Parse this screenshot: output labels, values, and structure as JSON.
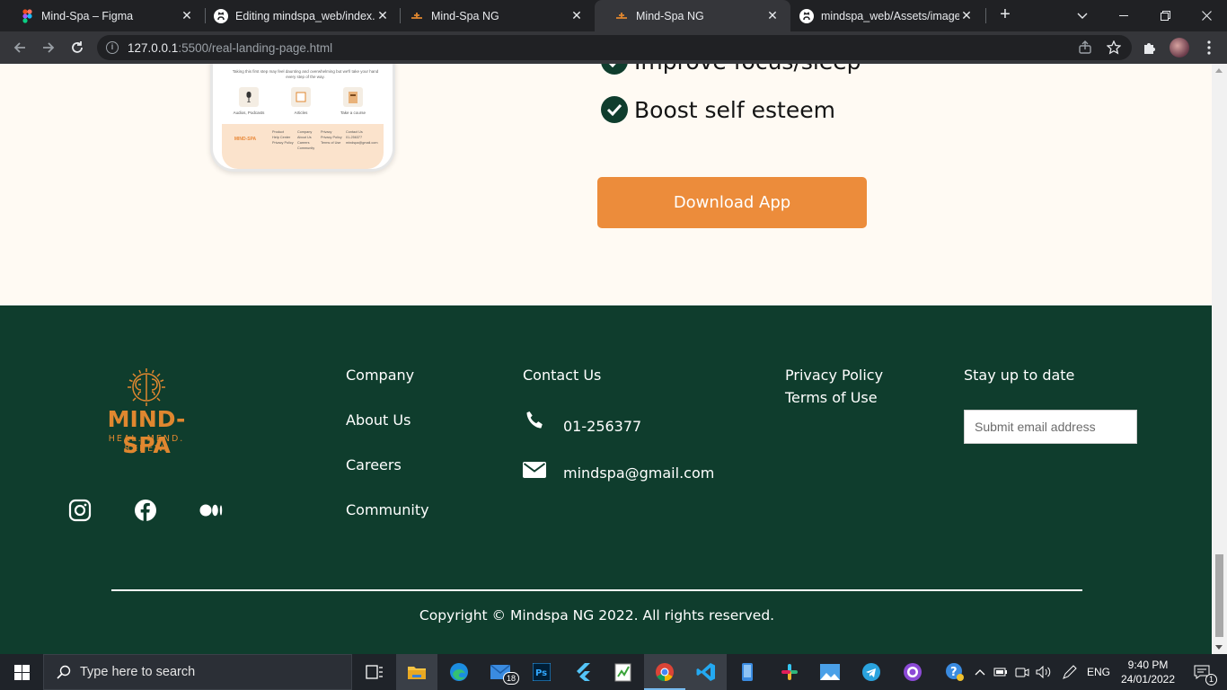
{
  "browser": {
    "tabs": [
      {
        "title": "Mind-Spa – Figma",
        "icon": "figma-icon"
      },
      {
        "title": "Editing mindspa_web/index.h",
        "icon": "github-icon"
      },
      {
        "title": "Mind-Spa NG",
        "icon": "mindspa-favicon-icon"
      },
      {
        "title": "Mind-Spa NG",
        "icon": "mindspa-favicon-icon",
        "active": true
      },
      {
        "title": "mindspa_web/Assets/images",
        "icon": "github-icon"
      }
    ],
    "url_host": "127.0.0.1",
    "url_path": ":5500/real-landing-page.html"
  },
  "phone_mockup": {
    "intro_text": "Taking this first step may feel daunting and overwhelming but we'll take your hand every step of the way.",
    "categories": [
      "Audios, Podcasts",
      "Articles",
      "Take a course"
    ],
    "footer_logo": "MIND-SPA",
    "footer_cols": [
      {
        "title": "Product",
        "items": [
          "Help Center",
          "Privacy Policy"
        ]
      },
      {
        "title": "Company",
        "items": [
          "About Us",
          "Careers",
          "Community"
        ]
      },
      {
        "title": "Privacy",
        "items": [
          "Privacy Policy",
          "Terms of Use"
        ]
      },
      {
        "title": "Contact Us",
        "items": [
          "01-256377",
          "mindspa@gmail.com"
        ]
      }
    ]
  },
  "benefits": {
    "items": [
      "Improve focus/sleep",
      "Boost self esteem"
    ]
  },
  "download_button": "Download App",
  "footer": {
    "logo_name": "MIND-SPA",
    "logo_tagline": "HEAL. MEND. RENEW.",
    "social": [
      "instagram-icon",
      "facebook-icon",
      "medium-icon"
    ],
    "company": {
      "title": "Company",
      "links": [
        "About Us",
        "Careers",
        "Community"
      ]
    },
    "contact": {
      "title": "Contact Us",
      "phone": "01-256377",
      "email": "mindspa@gmail.com"
    },
    "legal": {
      "links": [
        "Privacy Policy",
        "Terms of Use"
      ]
    },
    "newsletter": {
      "title": "Stay up to date",
      "placeholder": "Submit email address"
    },
    "copyright": "Copyright © Mindspa NG 2022. All rights reserved."
  },
  "taskbar": {
    "search_placeholder": "Type here to search",
    "mail_badge": "18",
    "language": "ENG",
    "time": "9:40 PM",
    "date": "24/01/2022",
    "notification_count": "1"
  },
  "colors": {
    "footer_bg": "#0f3d2d",
    "accent_orange": "#ec8c3b",
    "page_bg": "#fffaf3"
  }
}
